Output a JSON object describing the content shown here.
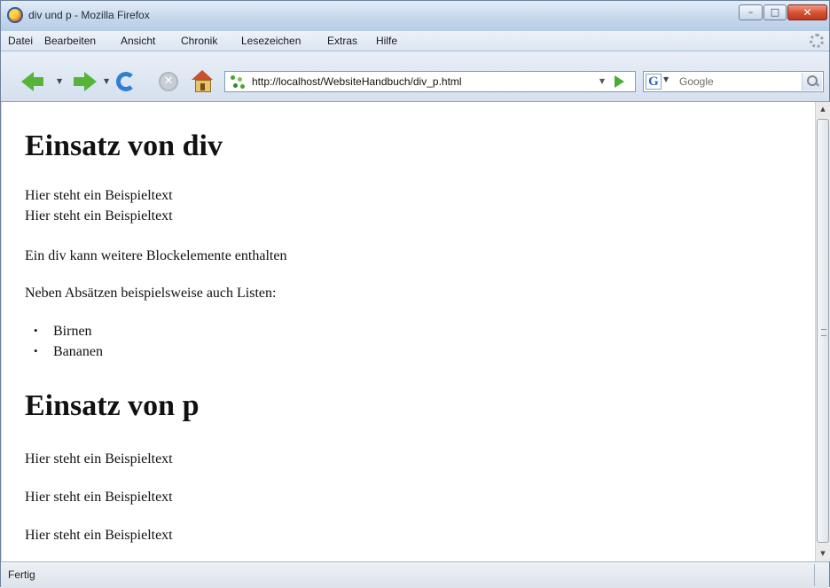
{
  "window": {
    "title": "div und p - Mozilla Firefox"
  },
  "menu": [
    "Datei",
    "Bearbeiten",
    "Ansicht",
    "Chronik",
    "Lesezeichen",
    "Extras",
    "Hilfe"
  ],
  "navigation": {
    "url": "http://localhost/WebsiteHandbuch/div_p.html",
    "search_placeholder": "Google"
  },
  "content": {
    "heading1": "Einsatz von div",
    "line1": "Hier steht ein Beispieltext",
    "line2": "Hier steht ein Beispieltext",
    "para1": "Ein div kann weitere Blockelemente enthalten",
    "para2": "Neben Absätzen beispielsweise auch Listen:",
    "list": [
      "Birnen",
      "Bananen"
    ],
    "heading2": "Einsatz von p",
    "p1": "Hier steht ein Beispieltext",
    "p2": "Hier steht ein Beispieltext",
    "p3": "Hier steht ein Beispieltext"
  },
  "status": "Fertig",
  "icons": {
    "app": "firefox-icon",
    "back": "back-arrow-icon",
    "forward": "forward-arrow-icon",
    "reload": "reload-icon",
    "stop": "stop-icon",
    "home": "home-icon",
    "go": "go-arrow-icon",
    "search": "magnifier-icon"
  },
  "colors": {
    "accent_green": "#57b43a",
    "reload_blue": "#2f7fd3",
    "close_red": "#d44f32"
  }
}
